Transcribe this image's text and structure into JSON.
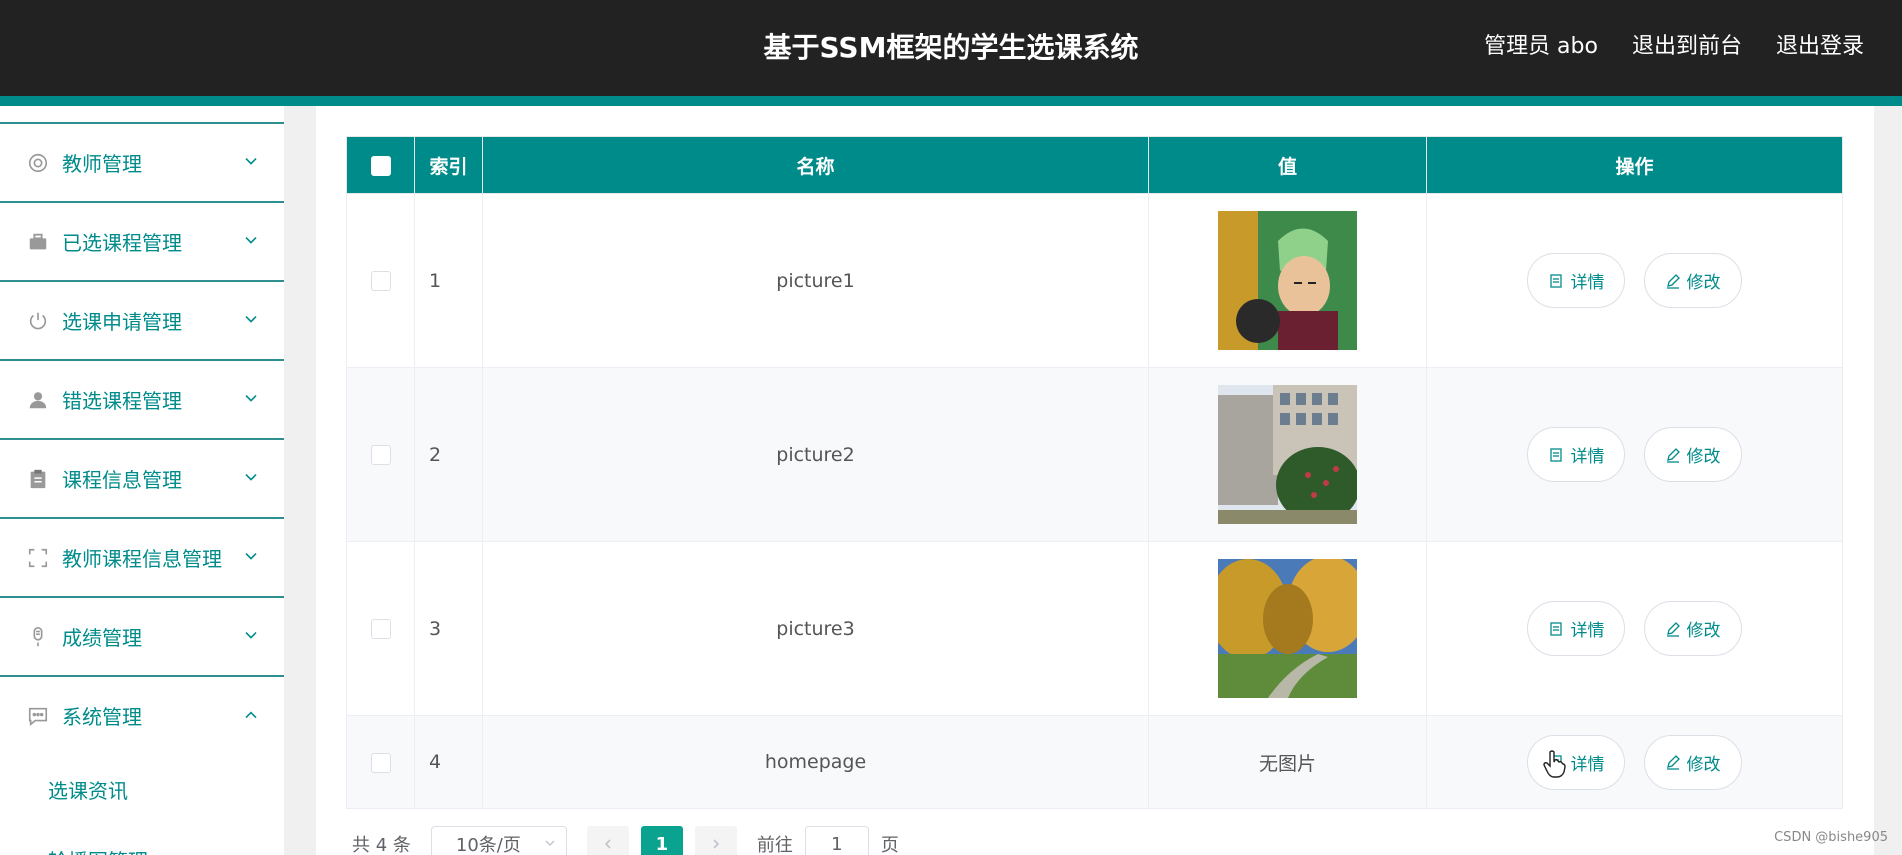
{
  "header": {
    "title": "基于SSM框架的学生选课系统",
    "user": "管理员 abo",
    "to_frontend": "退出到前台",
    "logout": "退出登录"
  },
  "sidebar": {
    "items": [
      {
        "label": "教师管理",
        "icon": "lifebuoy-icon"
      },
      {
        "label": "已选课程管理",
        "icon": "briefcase-icon"
      },
      {
        "label": "选课申请管理",
        "icon": "power-icon"
      },
      {
        "label": "错选课程管理",
        "icon": "user-icon"
      },
      {
        "label": "课程信息管理",
        "icon": "clipboard-icon"
      },
      {
        "label": "教师课程信息管理",
        "icon": "fullscreen-icon"
      },
      {
        "label": "成绩管理",
        "icon": "microphone-icon"
      },
      {
        "label": "系统管理",
        "icon": "chat-icon",
        "expanded": true
      }
    ],
    "sub_items": [
      "选课资讯",
      "轮播图管理"
    ]
  },
  "table": {
    "columns": [
      "索引",
      "名称",
      "值",
      "操作"
    ],
    "rows": [
      {
        "index": "1",
        "name": "picture1",
        "value_type": "image",
        "image": "anime-character"
      },
      {
        "index": "2",
        "name": "picture2",
        "value_type": "image",
        "image": "building-photo"
      },
      {
        "index": "3",
        "name": "picture3",
        "value_type": "image",
        "image": "autumn-campus"
      },
      {
        "index": "4",
        "name": "homepage",
        "value_type": "text",
        "value": "无图片"
      }
    ],
    "detail_label": "详情",
    "edit_label": "修改"
  },
  "pagination": {
    "total": "共 4 条",
    "page_size": "10条/页",
    "current_page": "1",
    "goto_prefix": "前往",
    "goto_value": "1",
    "goto_suffix": "页"
  },
  "watermark": "CSDN @bishe905",
  "colors": {
    "accent": "#008b8b",
    "header_bg": "#222222",
    "active_page": "#0aa38f"
  }
}
